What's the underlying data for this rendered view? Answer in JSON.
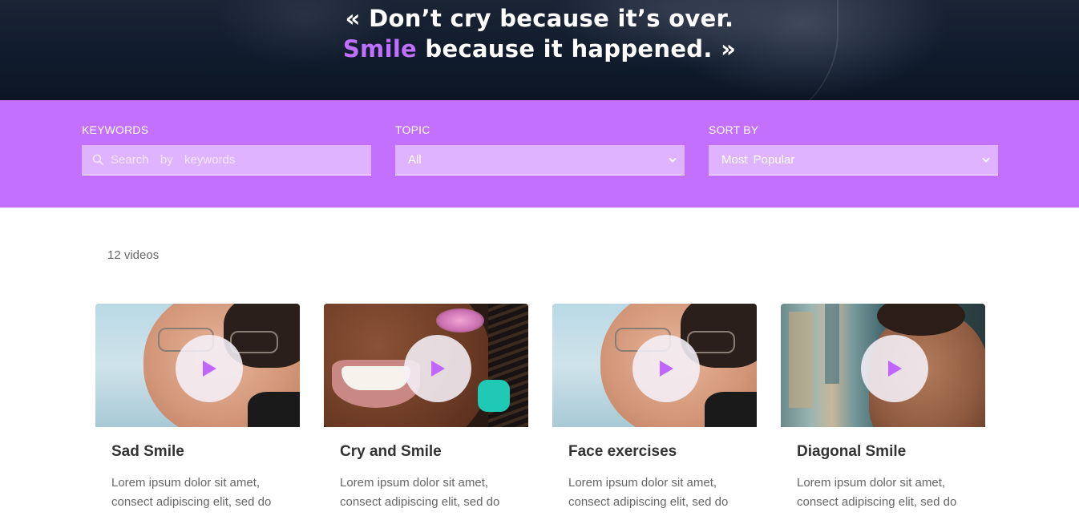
{
  "hero": {
    "quote_line1": "« Don’t cry because it’s over.",
    "quote_accent": "Smile",
    "quote_line2_rest": " because it happened. »"
  },
  "filters": {
    "keywords": {
      "label": "KEYWORDS",
      "placeholder": "Search  by  keywords",
      "value": ""
    },
    "topic": {
      "label": "TOPIC",
      "value": "All"
    },
    "sort": {
      "label": "SORT BY",
      "value": "Most  Popular"
    }
  },
  "results": {
    "count_text": "12 videos",
    "cards": [
      {
        "title": "Sad Smile",
        "desc": "Lorem ipsum dolor sit amet, consect adipiscing elit, sed do"
      },
      {
        "title": "Cry and Smile",
        "desc": "Lorem ipsum dolor sit amet, consect adipiscing elit, sed do"
      },
      {
        "title": "Face exercises",
        "desc": "Lorem ipsum dolor sit amet, consect adipiscing elit, sed do"
      },
      {
        "title": "Diagonal Smile",
        "desc": "Lorem ipsum dolor sit amet, consect adipiscing elit, sed do"
      }
    ]
  },
  "colors": {
    "accent": "#c370ff",
    "hero_bg": "#0f1a2b",
    "play_triangle": "#c066ff"
  },
  "icons": [
    "search-icon",
    "chevron-down-icon",
    "play-icon"
  ]
}
